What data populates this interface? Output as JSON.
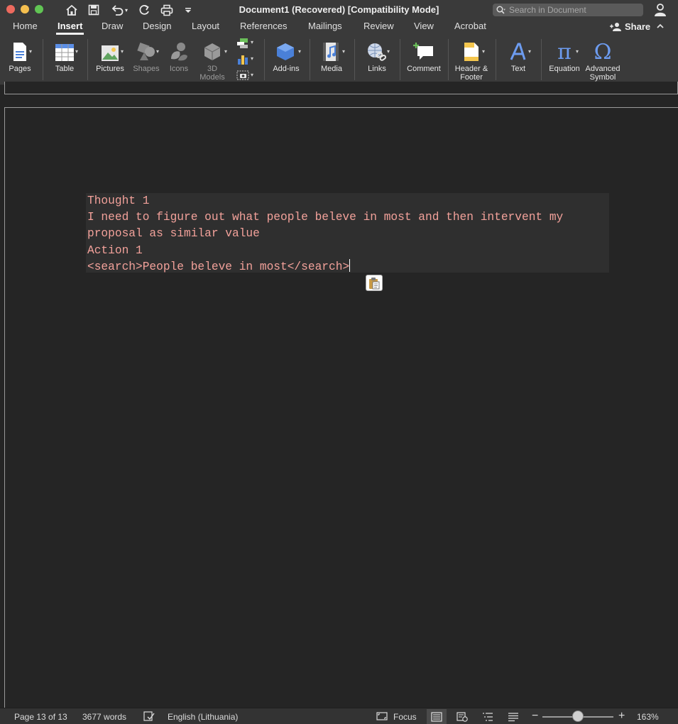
{
  "window": {
    "title": "Document1 (Recovered) [Compatibility Mode]",
    "search_placeholder": "Search in Document"
  },
  "quick_access": [
    "home-icon",
    "save-icon",
    "undo-icon",
    "redo-icon",
    "print-icon",
    "customize-icon"
  ],
  "tabs": [
    {
      "label": "Home"
    },
    {
      "label": "Insert",
      "active": true
    },
    {
      "label": "Draw"
    },
    {
      "label": "Design"
    },
    {
      "label": "Layout"
    },
    {
      "label": "References"
    },
    {
      "label": "Mailings"
    },
    {
      "label": "Review"
    },
    {
      "label": "View"
    },
    {
      "label": "Acrobat"
    }
  ],
  "share_label": "Share",
  "ribbon": {
    "pages": "Pages",
    "table": "Table",
    "pictures": "Pictures",
    "shapes": "Shapes",
    "icons": "Icons",
    "models_line1": "3D",
    "models_line2": "Models",
    "addins": "Add-ins",
    "media": "Media",
    "links": "Links",
    "comment": "Comment",
    "header_line1": "Header &",
    "header_line2": "Footer",
    "text": "Text",
    "equation": "Equation",
    "symbol_line1": "Advanced",
    "symbol_line2": "Symbol",
    "equation_glyph": "π",
    "symbol_glyph": "Ω"
  },
  "document": {
    "lines": [
      "Thought 1",
      "I need to figure out what people beleve in most and then intervent my",
      "proposal as similar value",
      "Action 1",
      "<search>People beleve in most</search>"
    ],
    "text_color": "#f2a19a"
  },
  "status": {
    "page": "Page 13 of 13",
    "words": "3677 words",
    "language": "English (Lithuania)",
    "focus": "Focus",
    "zoom": "163%",
    "zoom_level": 0.5
  }
}
